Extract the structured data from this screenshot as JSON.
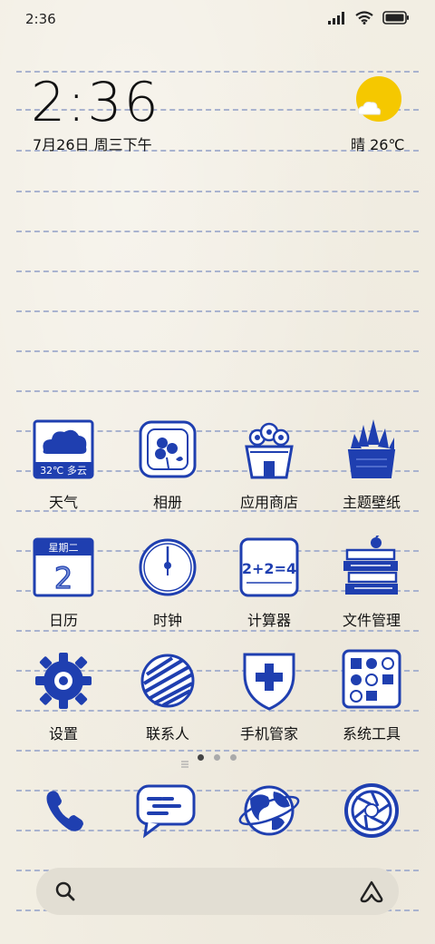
{
  "status_bar": {
    "time": "2:36",
    "icons": [
      "signal-icon",
      "wifi-icon",
      "battery-icon"
    ]
  },
  "clock_widget": {
    "time": "2:36",
    "date": "7月26日 周三下午"
  },
  "weather_widget": {
    "condition_temp": "晴 26℃",
    "icon": "sun-cloud-icon"
  },
  "apps": [
    {
      "label": "天气",
      "icon": "weather-app-icon",
      "badge": "32℃ 多云"
    },
    {
      "label": "相册",
      "icon": "gallery-app-icon"
    },
    {
      "label": "应用商店",
      "icon": "app-store-icon"
    },
    {
      "label": "主题壁纸",
      "icon": "themes-app-icon"
    },
    {
      "label": "日历",
      "icon": "calendar-app-icon",
      "badge": "星期二",
      "day": "2"
    },
    {
      "label": "时钟",
      "icon": "clock-app-icon"
    },
    {
      "label": "计算器",
      "icon": "calculator-app-icon",
      "badge": "2+2=4"
    },
    {
      "label": "文件管理",
      "icon": "file-manager-icon"
    },
    {
      "label": "设置",
      "icon": "settings-app-icon"
    },
    {
      "label": "联系人",
      "icon": "contacts-app-icon"
    },
    {
      "label": "手机管家",
      "icon": "security-app-icon"
    },
    {
      "label": "系统工具",
      "icon": "system-tools-icon"
    }
  ],
  "page_indicator": {
    "pages": 3,
    "current": 1
  },
  "dock": [
    {
      "icon": "phone-icon"
    },
    {
      "icon": "messages-icon"
    },
    {
      "icon": "browser-icon"
    },
    {
      "icon": "camera-icon"
    }
  ],
  "search_bar": {
    "left_icon": "search-icon",
    "right_icon": "assistant-icon"
  },
  "colors": {
    "ink_blue": "#1f3fb0",
    "paper": "#f2eee3",
    "rule": "#a9b3cf",
    "sun": "#f5c800"
  }
}
